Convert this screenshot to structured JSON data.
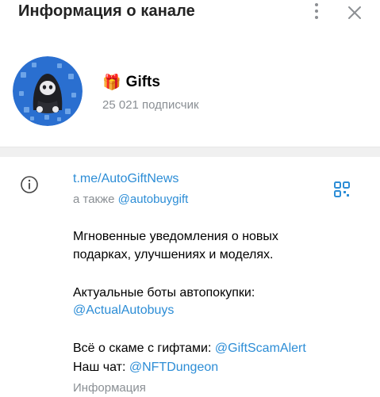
{
  "header": {
    "title": "Информация о канале",
    "menu_icon": "more-vertical-icon",
    "close_icon": "close-icon"
  },
  "channel": {
    "emoji": "🎁",
    "name": "Gifts",
    "subscribers": "25 021 подписчик"
  },
  "info": {
    "link": "t.me/AutoGiftNews",
    "also_prefix": "а также",
    "also_link": "@autobuygift",
    "description_line1": "Мгновенные уведомления о новых",
    "description_line2": "подарках, улучшениях и моделях.",
    "bots_label": "Актуальные боты автопокупки:",
    "bots_link": "@ActualAutobuys",
    "scam_prefix": "Всё о скаме с гифтами:",
    "scam_link": "@GiftScamAlert",
    "chat_prefix": "Наш чат:",
    "chat_link": "@NFTDungeon",
    "section_label": "Информация"
  },
  "colors": {
    "link": "#2c8dd6",
    "muted": "#8a8f94",
    "avatar_bg": "#2a6fd0"
  }
}
